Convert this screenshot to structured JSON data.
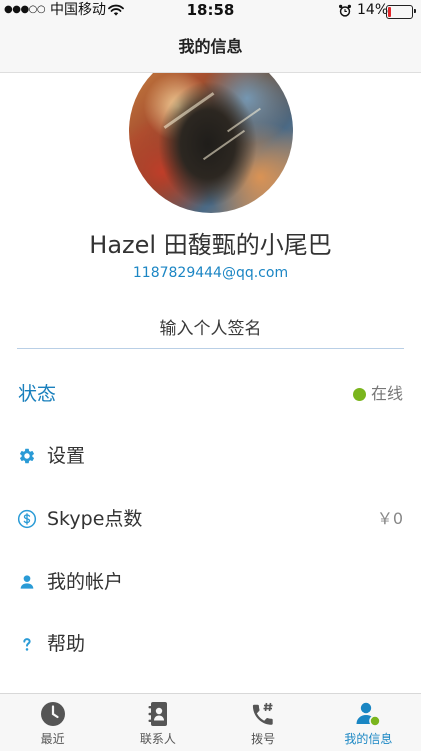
{
  "status_bar": {
    "signal": "●●●○○",
    "carrier": "中国移动",
    "time": "18:58",
    "battery_text": "14%",
    "battery_level": 0.14
  },
  "nav": {
    "title": "我的信息"
  },
  "profile": {
    "name": "Hazel 田馥甄的小尾巴",
    "email": "1187829444@qq.com",
    "signature_placeholder": "输入个人签名"
  },
  "presence": {
    "label": "状态",
    "value": "在线",
    "dot_color": "#7ab51d"
  },
  "menu": [
    {
      "icon": "gear-icon",
      "label": "设置"
    },
    {
      "icon": "skype-credit-icon",
      "label": "Skype点数",
      "value": "￥0"
    },
    {
      "icon": "person-icon",
      "label": "我的帐户"
    },
    {
      "icon": "help-icon",
      "label": "帮助"
    }
  ],
  "tabs": [
    {
      "icon": "clock-icon",
      "label": "最近",
      "selected": false
    },
    {
      "icon": "contacts-icon",
      "label": "联系人",
      "selected": false
    },
    {
      "icon": "dialpad-phone-icon",
      "label": "拨号",
      "selected": false
    },
    {
      "icon": "my-info-icon",
      "label": "我的信息",
      "selected": true
    }
  ],
  "colors": {
    "accent": "#1a86c3",
    "icon_blue": "#2a9bd6",
    "online": "#7ab51d",
    "battery_low": "#e2262a",
    "tab_inactive": "#555555"
  }
}
